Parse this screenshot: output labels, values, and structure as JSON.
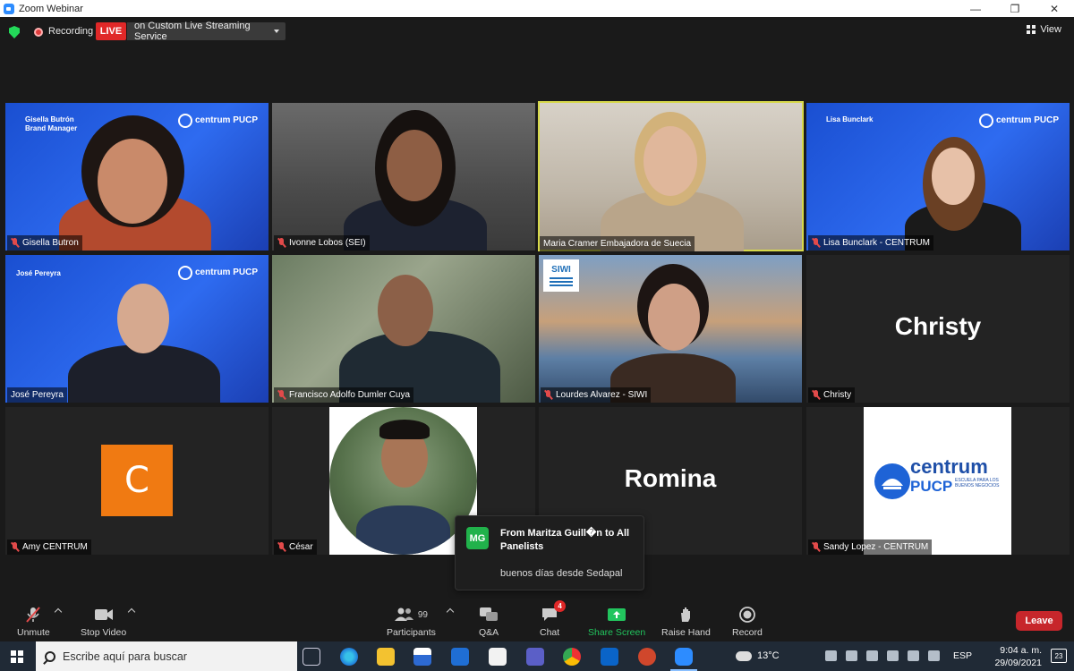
{
  "window": {
    "title": "Zoom Webinar",
    "controls": [
      "—",
      "❐",
      "✕"
    ]
  },
  "topbar": {
    "recording_label": "Recording",
    "live_label": "LIVE",
    "stream_label": "on Custom Live Streaming Service",
    "view_label": "View"
  },
  "tiles": [
    {
      "name": "Gisella Butron",
      "overlay": "Gisella Butrón\nBrand Manager",
      "logo": "centrum PUCP"
    },
    {
      "name": "Ivonne Lobos (SEI)"
    },
    {
      "name": "Maria Cramer Embajadora de Suecia",
      "active_speaker": true
    },
    {
      "name": "Lisa Bunclark - CENTRUM",
      "overlay": "Lisa Bunclark",
      "logo": "centrum PUCP"
    },
    {
      "name": "José Pereyra",
      "overlay": "José Pereyra",
      "logo": "centrum PUCP"
    },
    {
      "name": "Francisco Adolfo Dumler Cuya"
    },
    {
      "name": "Lourdes Alvarez - SIWI",
      "logo": "SIWI"
    },
    {
      "name": "Christy",
      "big_name": "Christy"
    },
    {
      "name": "Amy CENTRUM",
      "avatar_letter": "C"
    },
    {
      "name": "César"
    },
    {
      "name": "Romina",
      "big_name": "Romina"
    },
    {
      "name": "Sandy Lopez - CENTRUM",
      "card_logo": "centrum",
      "card_logo_sub": "PUCP",
      "card_tagline": "ESCUELA PARA LOS BUENOS NEGOCIOS"
    }
  ],
  "chat_popup": {
    "initials": "MG",
    "from": "From Maritza Guill�n to All Panelists",
    "message": "buenos días desde Sedapal",
    "accent": "#21b24b"
  },
  "controls": {
    "unmute": "Unmute",
    "stop_video": "Stop Video",
    "participants": "Participants",
    "participants_count": "99",
    "qa": "Q&A",
    "chat": "Chat",
    "chat_badge": "4",
    "share_screen": "Share Screen",
    "raise_hand": "Raise Hand",
    "record": "Record",
    "leave": "Leave"
  },
  "taskbar": {
    "search_placeholder": "Escribe aquí para buscar",
    "temperature": "13°C",
    "language": "ESP",
    "time": "9:04 a. m.",
    "date": "29/09/2021",
    "notifications": "23"
  },
  "colors": {
    "live_red": "#e02828",
    "active_speaker_outline": "#d7d94a",
    "share_green": "#22c55e",
    "leave_red": "#c7262b",
    "centrum_blue": "#2e6bf0"
  }
}
